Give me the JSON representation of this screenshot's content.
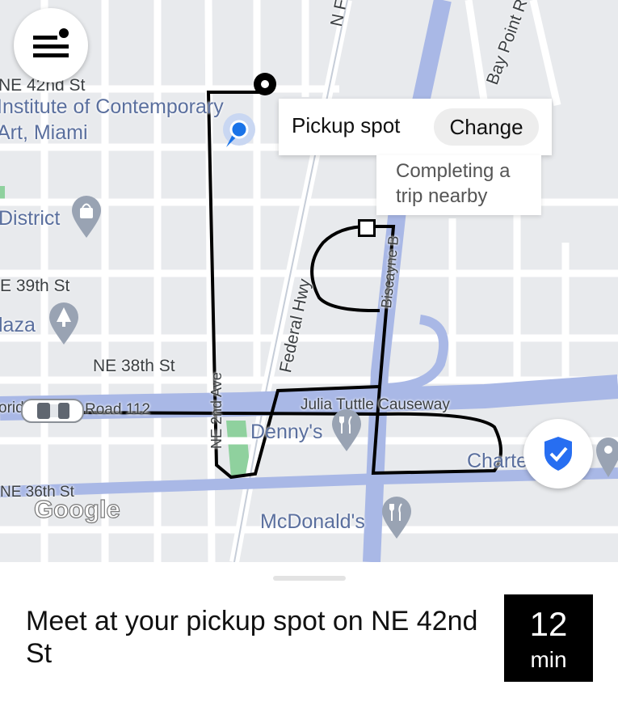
{
  "map": {
    "street_labels": {
      "ne_42nd": "NE 42nd St",
      "n_federal_hwy": "N Federal H",
      "bay_point": "Bay Point R",
      "e_39th": "E 39th St",
      "ne_38th": "NE 38th St",
      "ne_2nd_ave": "NE 2nd Ave",
      "federal_hwy": "Federal Hwy",
      "biscayne": "Biscayne B",
      "road_112": "Road 112",
      "florida_cut": "orid",
      "julia_tuttle": "Julia Tuttle Causeway",
      "ne_36th": "NE 36th St"
    },
    "places": {
      "ica_line1": "Institute of Contemporary",
      "ica_line2": "Art, Miami",
      "district": "District",
      "plaza": "laza",
      "dennys": "Denny's",
      "mcdonalds": "McDonald's",
      "charter": "Charte"
    },
    "attribution": "Google"
  },
  "pickup": {
    "label": "Pickup spot",
    "change_button": "Change"
  },
  "driver_status": "Completing a trip nearby",
  "sheet": {
    "message": "Meet at your pickup spot on NE 42nd St",
    "eta_value": "12",
    "eta_unit": "min"
  },
  "icons": [
    "menu-icon",
    "notification-dot-icon",
    "location-dot-icon",
    "shopping-bag-icon",
    "park-tree-icon",
    "restaurant-icon",
    "shield-check-icon",
    "car-icon",
    "map-pin-icon"
  ],
  "colors": {
    "highway": "#a9b8e6",
    "major_road": "#ffffff",
    "park": "#8fd19e",
    "poi_text": "#5a6f9e",
    "user_dot": "#1a73e8",
    "eta_bg": "#000000"
  }
}
